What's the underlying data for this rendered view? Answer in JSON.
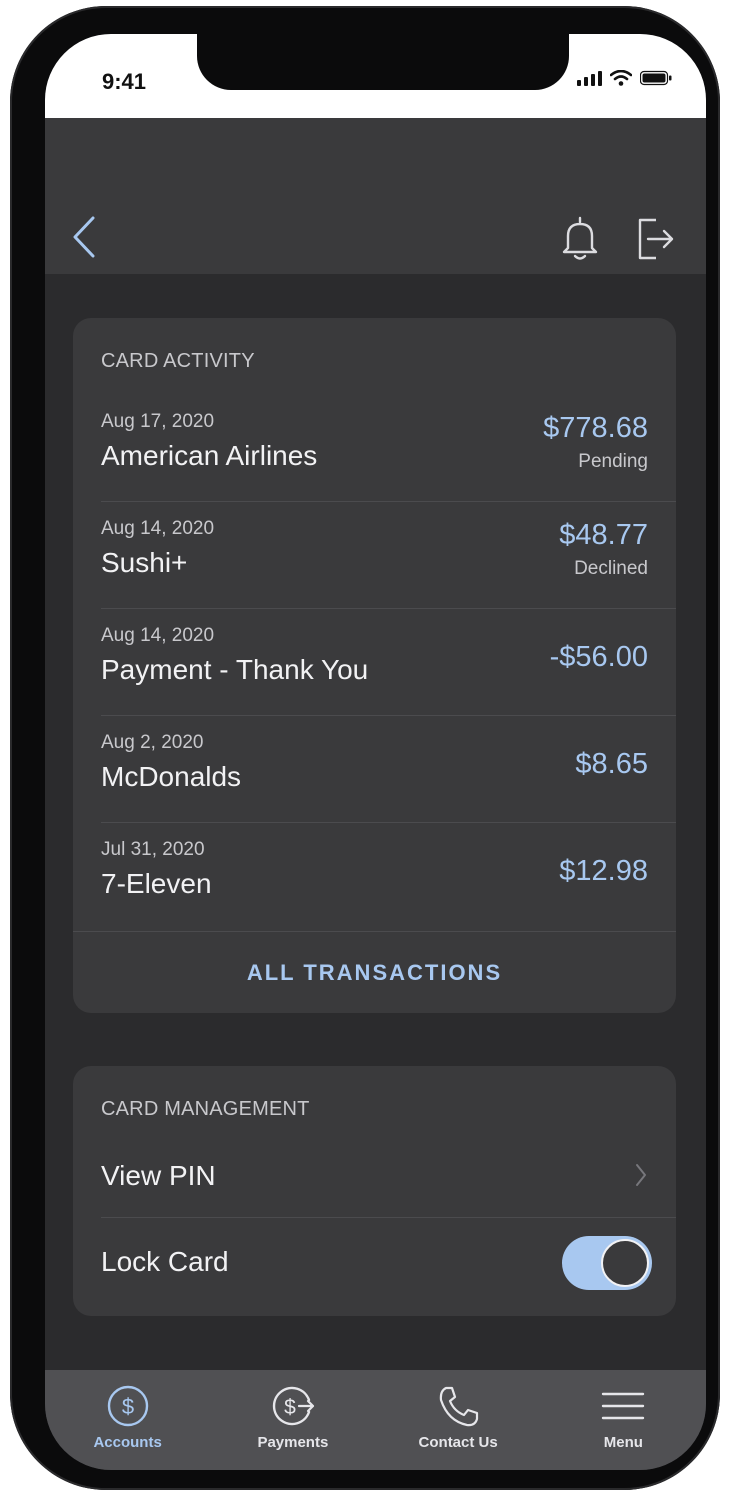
{
  "status_bar": {
    "time": "9:41"
  },
  "colors": {
    "accent": "#a8c8f0",
    "card_bg": "#3a3a3c",
    "screen_bg": "#2b2b2d",
    "text": "#f2f2f4",
    "muted": "#c8c8cc"
  },
  "header": {
    "icons": [
      "back-chevron-icon",
      "bell-icon",
      "logout-icon"
    ]
  },
  "card_activity": {
    "title": "CARD ACTIVITY",
    "transactions": [
      {
        "date": "Aug 17, 2020",
        "merchant": "American Airlines",
        "amount": "$778.68",
        "status": "Pending"
      },
      {
        "date": "Aug 14, 2020",
        "merchant": "Sushi+",
        "amount": "$48.77",
        "status": "Declined"
      },
      {
        "date": "Aug 14, 2020",
        "merchant": "Payment - Thank You",
        "amount": "-$56.00",
        "status": ""
      },
      {
        "date": "Aug 2, 2020",
        "merchant": "McDonalds",
        "amount": "$8.65",
        "status": ""
      },
      {
        "date": "Jul 31, 2020",
        "merchant": "7-Eleven",
        "amount": "$12.98",
        "status": ""
      }
    ],
    "all_transactions_label": "ALL TRANSACTIONS"
  },
  "card_management": {
    "title": "CARD MANAGEMENT",
    "view_pin_label": "View PIN",
    "lock_card_label": "Lock Card",
    "lock_card_on": true
  },
  "tabbar": {
    "items": [
      {
        "label": "Accounts",
        "icon": "dollar-circle-icon",
        "active": true
      },
      {
        "label": "Payments",
        "icon": "payment-transfer-icon",
        "active": false
      },
      {
        "label": "Contact Us",
        "icon": "phone-icon",
        "active": false
      },
      {
        "label": "Menu",
        "icon": "menu-icon",
        "active": false
      }
    ]
  }
}
